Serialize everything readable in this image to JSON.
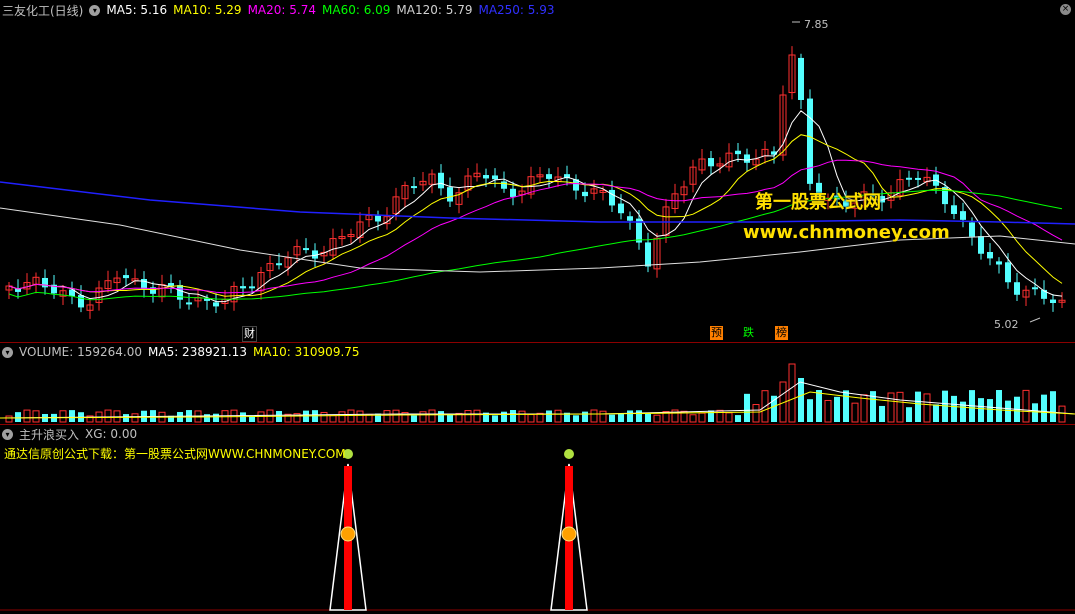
{
  "price_panel": {
    "stock_name": "三友化工(日线)",
    "ma_values": [
      {
        "text": "MA5: 5.16",
        "color": "#ffffff"
      },
      {
        "text": "MA10: 5.29",
        "color": "#ffff00"
      },
      {
        "text": "MA20: 5.74",
        "color": "#ff00ff"
      },
      {
        "text": "MA60: 6.09",
        "color": "#00ff00"
      },
      {
        "text": "MA120: 5.79",
        "color": "#d0d0d0"
      },
      {
        "text": "MA250: 5.93",
        "color": "#2020ff"
      }
    ],
    "high_label": "7.85",
    "low_label": "5.02",
    "watermark_title": "第一股票公式网",
    "watermark_url": "www.chnmoney.com",
    "event_markers": [
      {
        "text": "财",
        "bg": "#000000",
        "color": "#ffffff"
      },
      {
        "text": "预",
        "bg": "#ff8000",
        "color": "#000000"
      },
      {
        "text": "跌",
        "bg": "#000000",
        "color": "#00ff00"
      },
      {
        "text": "榜",
        "bg": "#ff8000",
        "color": "#000000"
      }
    ]
  },
  "volume_panel": {
    "volume_text": "VOLUME: 159264.00",
    "ma5_text": "MA5: 238921.13",
    "ma10_text": "MA10: 310909.75"
  },
  "indicator_panel": {
    "title": "主升浪买入",
    "xg_text": "XG: 0.00",
    "notice": "通达信原创公式下载：第一股票公式网WWW.CHNMONEY.COM"
  },
  "colors": {
    "up": "#ff3030",
    "down": "#54ffff",
    "separator": "#8b0000",
    "signal": "#ff0000"
  }
}
